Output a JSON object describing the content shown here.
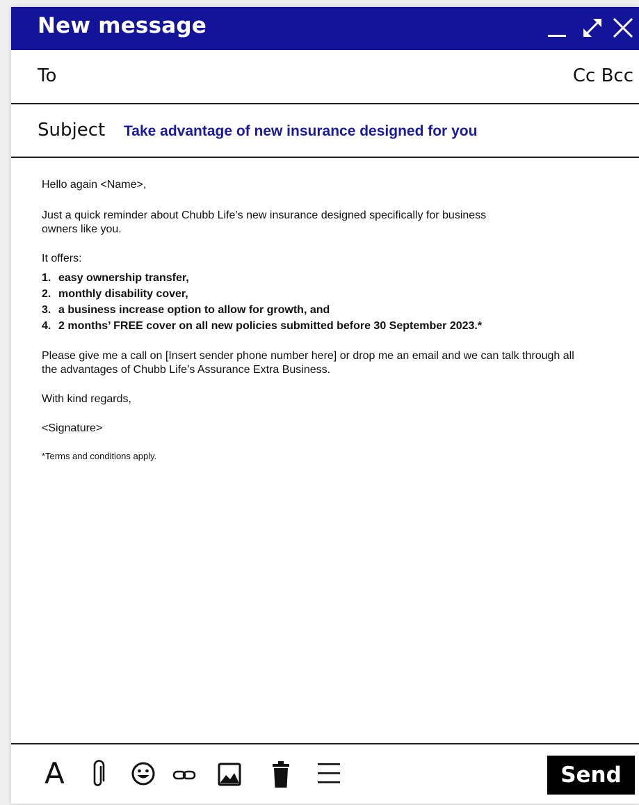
{
  "window": {
    "title": "New message"
  },
  "recipients": {
    "to_label": "To",
    "to_value": "",
    "cc_label": "Cc",
    "bcc_label": "Bcc"
  },
  "subject": {
    "label": "Subject",
    "value": "Take advantage of new insurance designed for you"
  },
  "message": {
    "greeting": "Hello again <Name>,",
    "intro": "Just a quick reminder about Chubb Life’s new insurance designed specifically for business owners like you.",
    "offers_intro": "It offers:",
    "offers": [
      {
        "num": "1.",
        "text": "easy ownership transfer,"
      },
      {
        "num": "2.",
        "text": "monthly disability cover,"
      },
      {
        "num": "3.",
        "text": "a business increase option to allow for growth, and"
      },
      {
        "num": "4.",
        "text": "2 months’ FREE cover on all new policies submitted before 30 September 2023.*"
      }
    ],
    "call_to_action": "Please give me a call on [Insert sender phone number here] or drop me an email and we can talk through all the advantages of Chubb Life’s Assurance Extra Business.",
    "regards": "With kind regards,",
    "signature": "<Signature>",
    "terms": "*Terms and conditions apply."
  },
  "toolbar": {
    "font_glyph": "A",
    "send_label": "Send",
    "icons": [
      "font-format-icon",
      "attachment-icon",
      "emoji-icon",
      "link-icon",
      "image-icon",
      "trash-icon",
      "more-options-icon"
    ]
  },
  "colors": {
    "titlebar": "#14149a",
    "subject_text": "#1a1aa0",
    "send_button": "#000000"
  }
}
